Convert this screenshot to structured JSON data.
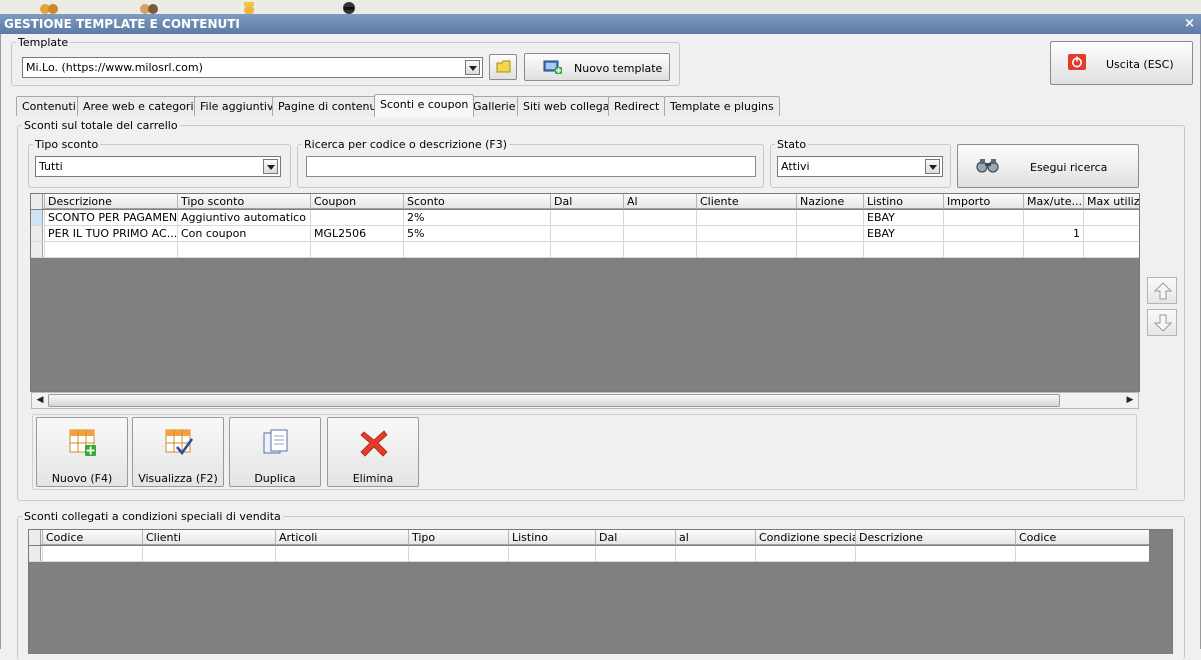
{
  "window": {
    "title": "GESTIONE TEMPLATE E CONTENUTI",
    "close": "×"
  },
  "template_group": {
    "label": "Template",
    "selected": "Mi.Lo. (https://www.milosrl.com)",
    "new_button": "Nuovo template"
  },
  "exit_button": "Uscita (ESC)",
  "tabs": [
    {
      "label": "Contenuti",
      "active": false
    },
    {
      "label": "Aree web e categorie",
      "active": false
    },
    {
      "label": "File aggiuntivi",
      "active": false
    },
    {
      "label": "Pagine di contenuti",
      "active": false
    },
    {
      "label": "Sconti e coupon",
      "active": true
    },
    {
      "label": "Gallerie",
      "active": false
    },
    {
      "label": "Siti web collegati",
      "active": false
    },
    {
      "label": "Redirect",
      "active": false
    },
    {
      "label": "Template e plugins",
      "active": false
    }
  ],
  "cart_section": {
    "label": "Sconti sul totale del carrello",
    "tipo_sconto": {
      "label": "Tipo sconto",
      "value": "Tutti"
    },
    "search": {
      "label": "Ricerca per codice o descrizione (F3)",
      "value": ""
    },
    "stato": {
      "label": "Stato",
      "value": "Attivi"
    },
    "search_button": "Esegui ricerca",
    "columns": [
      "Descrizione",
      "Tipo sconto",
      "Coupon",
      "Sconto",
      "Dal",
      "Al",
      "Cliente",
      "Nazione",
      "Listino",
      "Importo",
      "Max/ute...",
      "Max utilizzi"
    ],
    "rows": [
      [
        "SCONTO PER PAGAMEN...",
        "Aggiuntivo automatico",
        "",
        "2%",
        "",
        "",
        "",
        "",
        "EBAY",
        "",
        "",
        ""
      ],
      [
        "PER IL TUO PRIMO AC...",
        "Con coupon",
        "MGL2506",
        "5%",
        "",
        "",
        "",
        "",
        "EBAY",
        "",
        "1",
        ""
      ]
    ],
    "actions": {
      "new": "Nuovo (F4)",
      "view": "Visualizza (F2)",
      "duplicate": "Duplica",
      "delete": "Elimina"
    }
  },
  "special_section": {
    "label": "Sconti collegati a condizioni speciali di vendita",
    "columns": [
      "Codice",
      "Clienti",
      "Articoli",
      "Tipo",
      "Listino",
      "Dal",
      "al",
      "Condizione speciale",
      "Descrizione",
      "Codice"
    ]
  },
  "colors": {
    "titlebar": "#6a89b4",
    "grid_empty": "#808080",
    "accent_red": "#e53b2c"
  }
}
